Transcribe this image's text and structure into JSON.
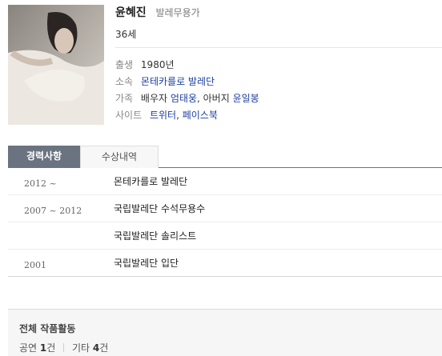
{
  "profile": {
    "name": "윤혜진",
    "job": "발레무용가",
    "age": "36세",
    "info": [
      {
        "label": "출생",
        "value": "1980년"
      },
      {
        "label": "소속",
        "value": "몬테카를로 발레단"
      },
      {
        "label": "가족",
        "prefix": "배우자 ",
        "link1": "엄태웅",
        "mid": ", 아버지 ",
        "link2": "윤일봉"
      },
      {
        "label": "사이트",
        "link1": "트위터",
        "mid": ", ",
        "link2": "페이스북"
      }
    ]
  },
  "tabs": {
    "career": "경력사항",
    "awards": "수상내역"
  },
  "career": [
    {
      "year": "2012 ~",
      "desc": "몬테카를로 발레단"
    },
    {
      "year": "2007 ~ 2012",
      "desc": "국립발레단 수석무용수"
    },
    {
      "year": "",
      "desc": "국립발레단 솔리스트"
    },
    {
      "year": "2001",
      "desc": "국립발레단 입단"
    }
  ],
  "works": {
    "title": "전체 작품활동",
    "perf_label": "공연",
    "perf_count": "1",
    "perf_unit": "건",
    "etc_label": "기타",
    "etc_count": "4",
    "etc_unit": "건"
  },
  "colors": {
    "link": "#1d3fa0",
    "tab_active_bg": "#6b7380",
    "tab_active_text": "#ffffff"
  }
}
